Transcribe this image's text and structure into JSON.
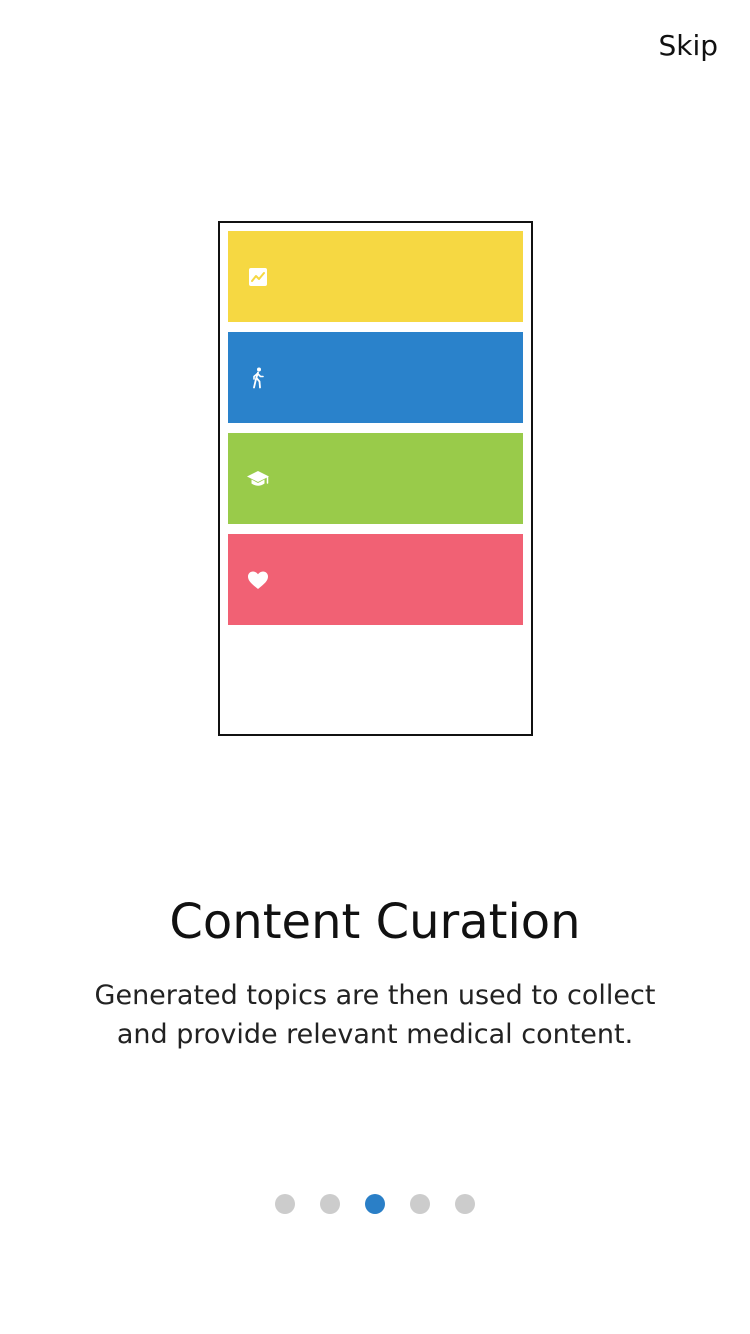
{
  "header": {
    "skip_label": "Skip"
  },
  "illustration": {
    "cards": [
      {
        "icon": "trend-chart-icon",
        "color": "#f6d842"
      },
      {
        "icon": "walking-person-icon",
        "color": "#2a82cb"
      },
      {
        "icon": "graduation-cap-icon",
        "color": "#99cb4a"
      },
      {
        "icon": "heart-icon",
        "color": "#f16174"
      }
    ]
  },
  "content": {
    "title": "Content Curation",
    "description_line1": "Generated topics are then used to collect",
    "description_line2": "and provide relevant medical content."
  },
  "pagination": {
    "total": 5,
    "current": 3,
    "active_color": "#2a7fc7",
    "inactive_color": "#cccccc"
  }
}
